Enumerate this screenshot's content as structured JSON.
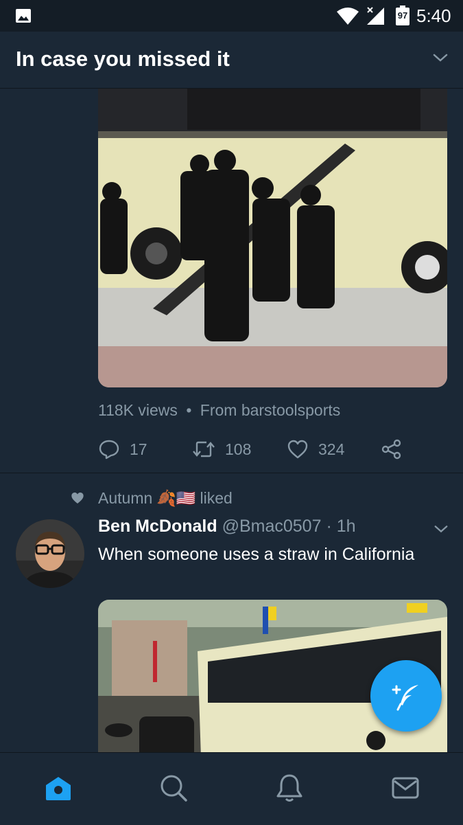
{
  "status_bar": {
    "time": "5:40",
    "battery_level": "97",
    "icons": [
      "gallery-icon",
      "wifi-icon",
      "signal-icon",
      "battery-icon"
    ]
  },
  "header": {
    "title": "In case you missed it",
    "menu_icon": "chevron-down-icon"
  },
  "tweet1": {
    "views": "118K views",
    "separator": "•",
    "source": "From barstoolsports",
    "reply_count": "17",
    "retweet_count": "108",
    "like_count": "324"
  },
  "tweet2": {
    "social_context": {
      "user": "Autumn",
      "emoji": "🍂🇺🇸",
      "action": "liked"
    },
    "name": "Ben McDonald",
    "handle": "@Bmac0507",
    "time": "· 1h",
    "text": "When someone uses a straw in California"
  },
  "bottom_nav": {
    "items": [
      "home-icon",
      "search-icon",
      "notifications-icon",
      "messages-icon"
    ],
    "active": "home-icon"
  },
  "colors": {
    "background": "#1b2836",
    "status_bar": "#141d26",
    "accent": "#1da1f2",
    "muted_text": "#8899a6"
  }
}
